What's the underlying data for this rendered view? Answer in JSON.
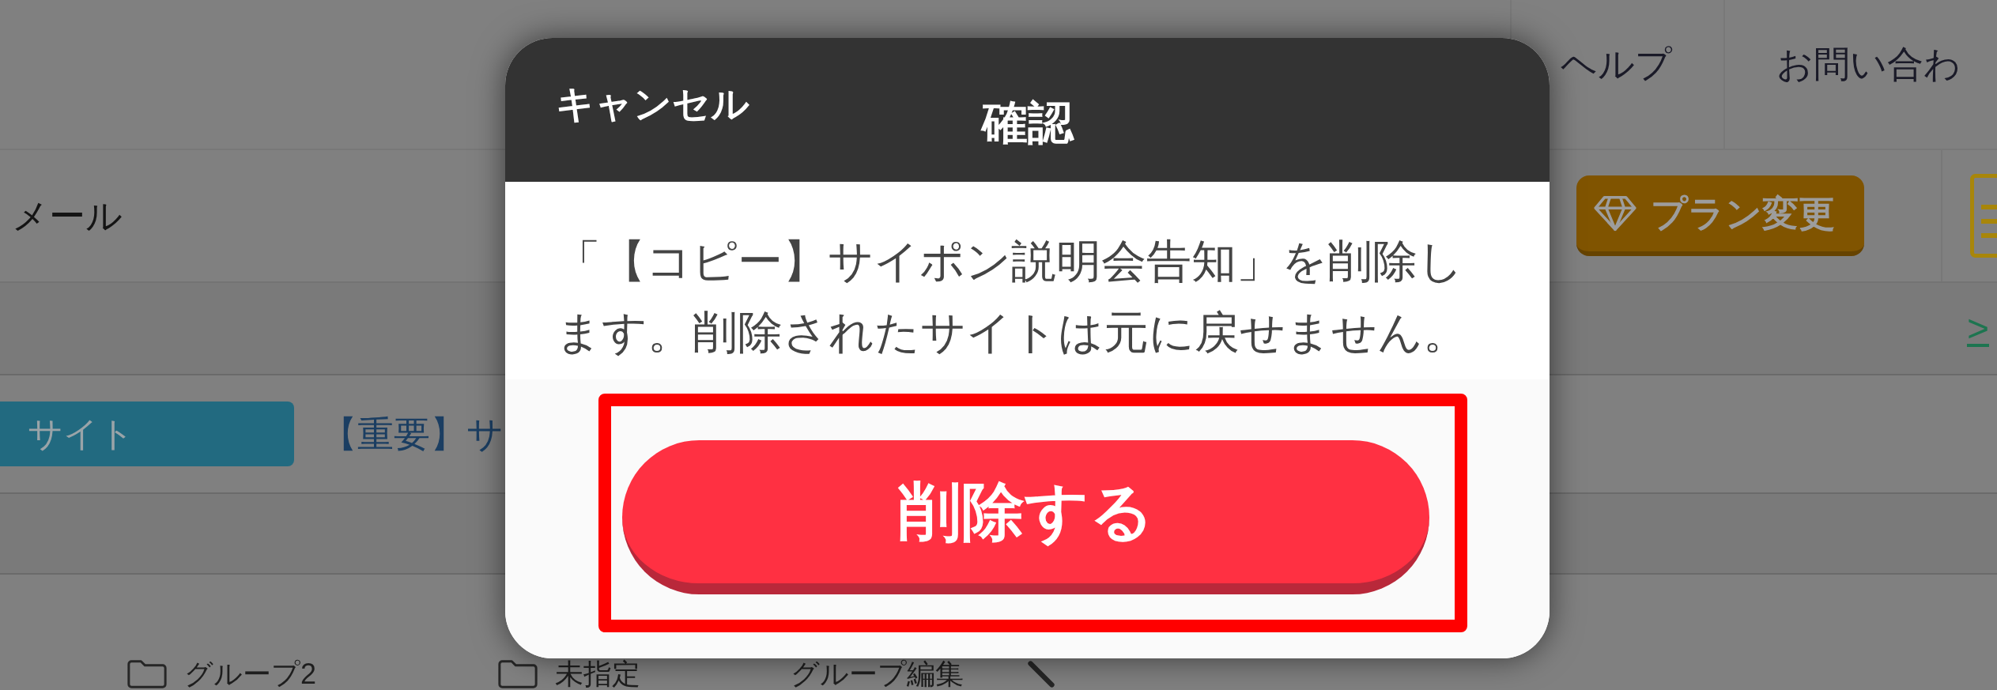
{
  "header": {
    "nav_links": [
      {
        "label": "ヘルプ"
      },
      {
        "label": "お問い合わ"
      }
    ]
  },
  "toolbar": {
    "title": "メール",
    "plan_button": {
      "label": "プラン変更"
    }
  },
  "notice_bar": {
    "link": ">"
  },
  "site_row": {
    "badge": "サイト",
    "title": "【重要】サ"
  },
  "group_bar": {
    "items": [
      {
        "kind": "folder",
        "label": "グループ2"
      },
      {
        "kind": "folder",
        "label": "未指定"
      },
      {
        "kind": "edit",
        "label": "グループ編集"
      }
    ]
  },
  "dialog": {
    "cancel": "キャンセル",
    "title": "確認",
    "message": "「【コピー】サイポン説明会告知」を削除します。削除されたサイトは元に戻せません。",
    "confirm_button": {
      "label": "削除する",
      "highlighted": true
    }
  }
}
